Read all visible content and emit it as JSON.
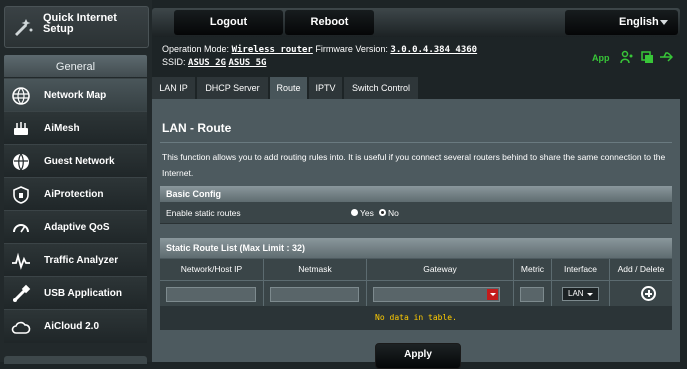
{
  "sidebar": {
    "quick_setup": "Quick Internet Setup",
    "section_general": "General",
    "items": [
      {
        "label": "Network Map"
      },
      {
        "label": "AiMesh"
      },
      {
        "label": "Guest Network"
      },
      {
        "label": "AiProtection"
      },
      {
        "label": "Adaptive QoS"
      },
      {
        "label": "Traffic Analyzer"
      },
      {
        "label": "USB Application"
      },
      {
        "label": "AiCloud 2.0"
      }
    ]
  },
  "header": {
    "logout": "Logout",
    "reboot": "Reboot",
    "language": "English"
  },
  "info": {
    "op_mode_label": "Operation Mode:",
    "op_mode_value": "Wireless router",
    "fw_label": "Firmware Version:",
    "fw_value": "3.0.0.4.384_4360",
    "ssid_label": "SSID:",
    "ssid_1": "ASUS_2G",
    "ssid_2": "ASUS_5G",
    "app": "App"
  },
  "tabs": [
    {
      "label": "LAN IP"
    },
    {
      "label": "DHCP Server"
    },
    {
      "label": "Route",
      "active": true
    },
    {
      "label": "IPTV"
    },
    {
      "label": "Switch Control"
    }
  ],
  "page": {
    "title": "LAN - Route",
    "description": "This function allows you to add routing rules into. It is useful if you connect several routers behind to share the same connection to the Internet.",
    "basic_config": "Basic Config",
    "enable_static_routes": "Enable static routes",
    "yes": "Yes",
    "no": "No",
    "selected": "No",
    "list_title": "Static Route List (Max Limit : 32)",
    "columns": [
      "Network/Host IP",
      "Netmask",
      "Gateway",
      "Metric",
      "Interface",
      "Add / Delete"
    ],
    "interface_value": "LAN",
    "no_data": "No data in table.",
    "apply": "Apply"
  },
  "colors": {
    "accent_red": "#c41b1b",
    "app_green": "#38c638",
    "no_data_yellow": "#ffcc00"
  }
}
